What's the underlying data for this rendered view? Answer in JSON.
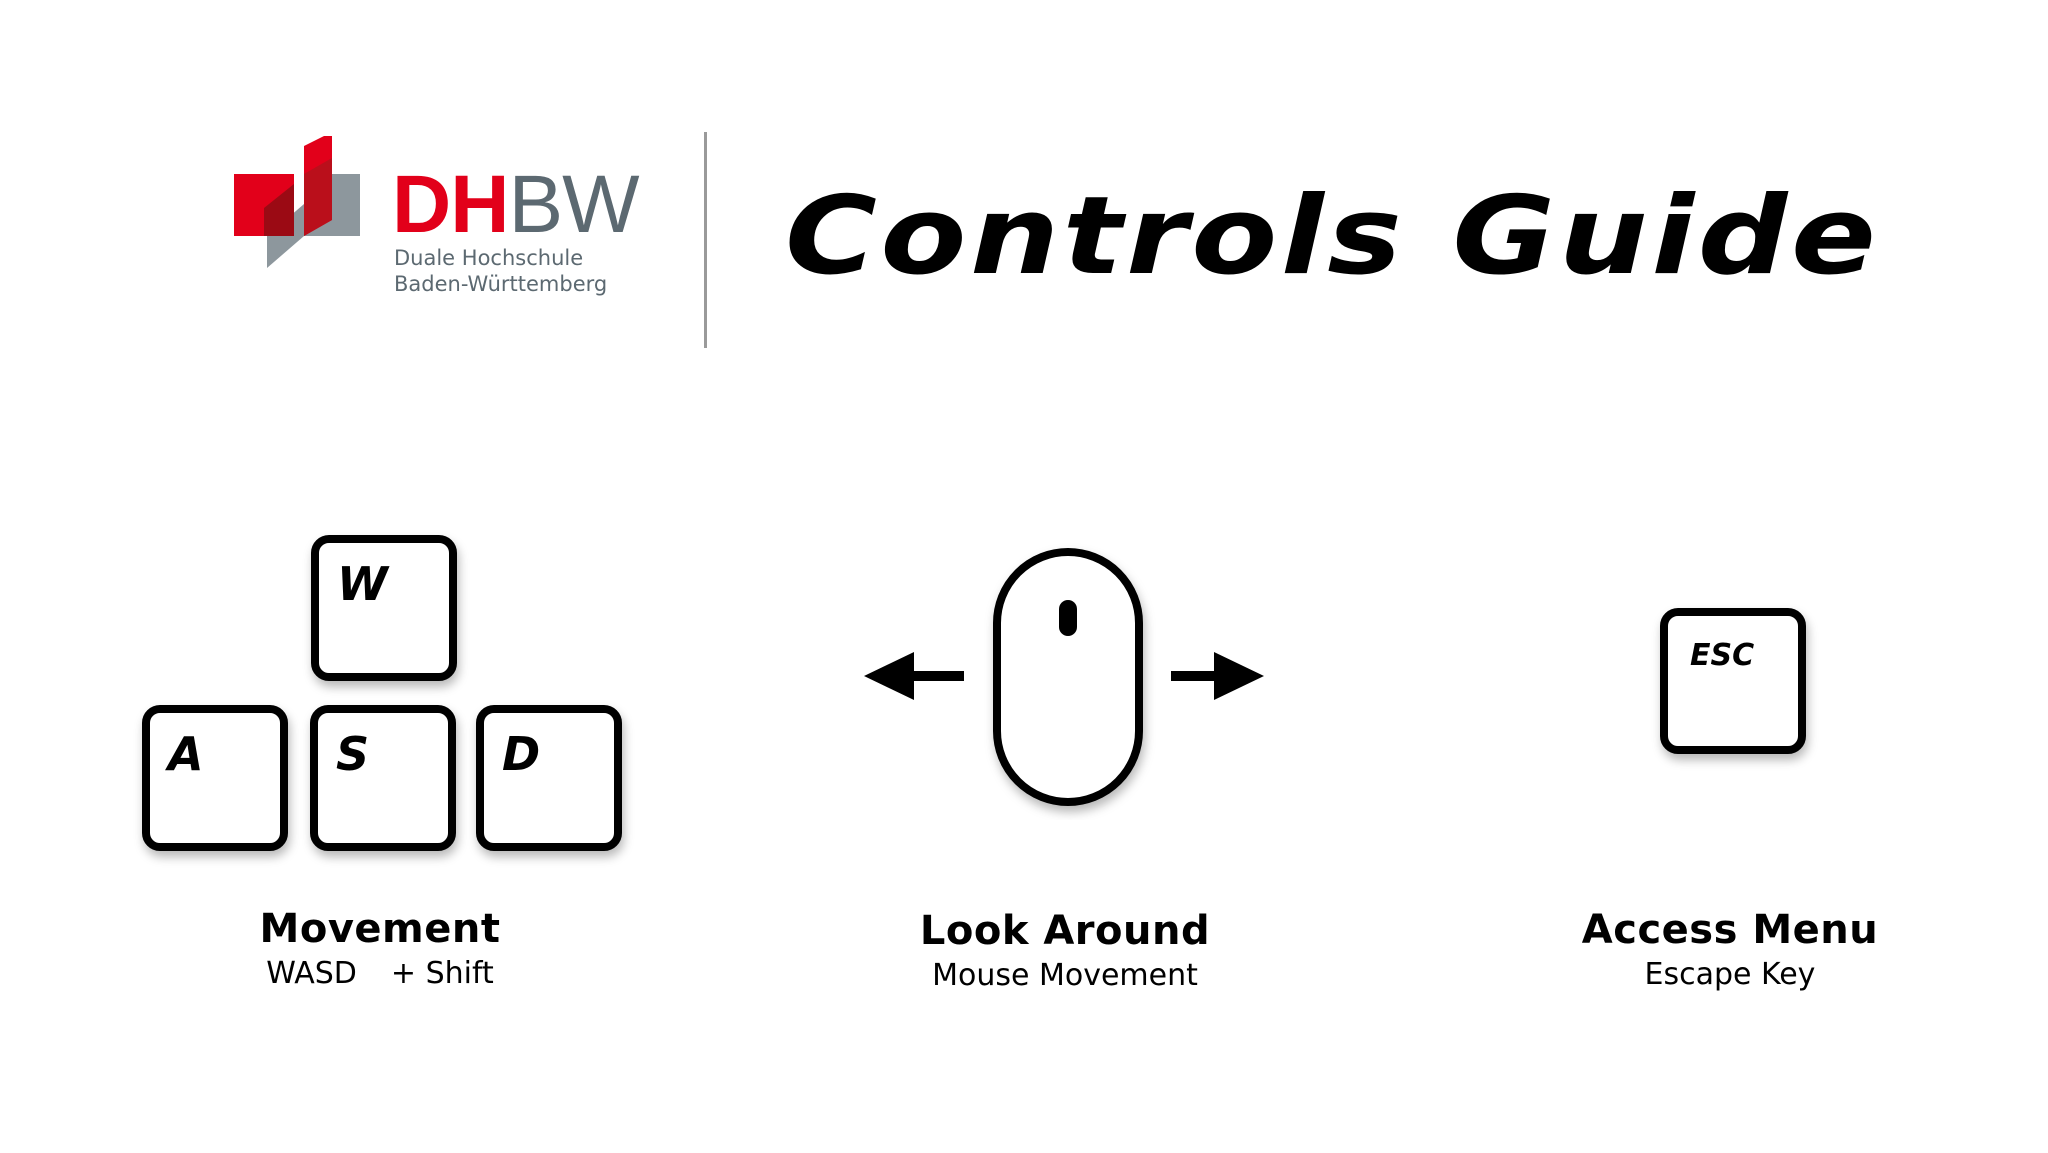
{
  "header": {
    "logo": {
      "wordmark_primary": "DH",
      "wordmark_secondary": "BW",
      "subtitle_line1": "Duale Hochschule",
      "subtitle_line2": "Baden-Württemberg",
      "colors": {
        "red": "#e2001a",
        "dark_red": "#9b0a14",
        "gray": "#5c6971",
        "light_gray": "#8d979d"
      }
    },
    "title": "Controls Guide"
  },
  "controls": {
    "movement": {
      "keys": [
        "W",
        "A",
        "S",
        "D"
      ],
      "title": "Movement",
      "subtitle_keys": "WASD",
      "subtitle_modifier": "+ Shift"
    },
    "look": {
      "icon": "mouse-icon",
      "arrows": [
        "arrow-left-icon",
        "arrow-right-icon"
      ],
      "title": "Look Around",
      "subtitle": "Mouse Movement"
    },
    "menu": {
      "key": "ESC",
      "title": "Access Menu",
      "subtitle": "Escape Key"
    }
  }
}
